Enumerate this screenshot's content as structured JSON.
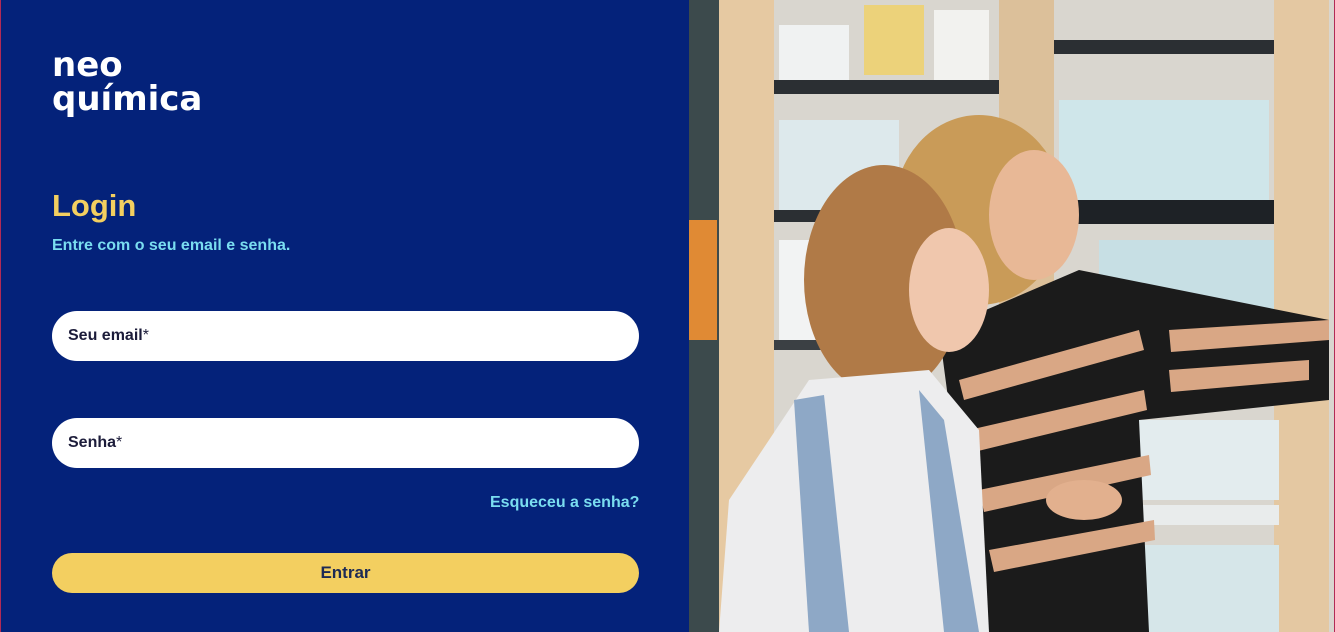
{
  "brand": {
    "line1": "neo",
    "line2": "química"
  },
  "login": {
    "title": "Login",
    "subtitle": "Entre com o seu email e senha.",
    "email_label": "Seu email",
    "password_label": "Senha",
    "required_mark": "*",
    "forgot": "Esqueceu a senha?",
    "submit": "Entrar"
  },
  "colors": {
    "background": "#04227A",
    "accent_yellow": "#F3CF60",
    "accent_cyan": "#7ADDF0"
  }
}
